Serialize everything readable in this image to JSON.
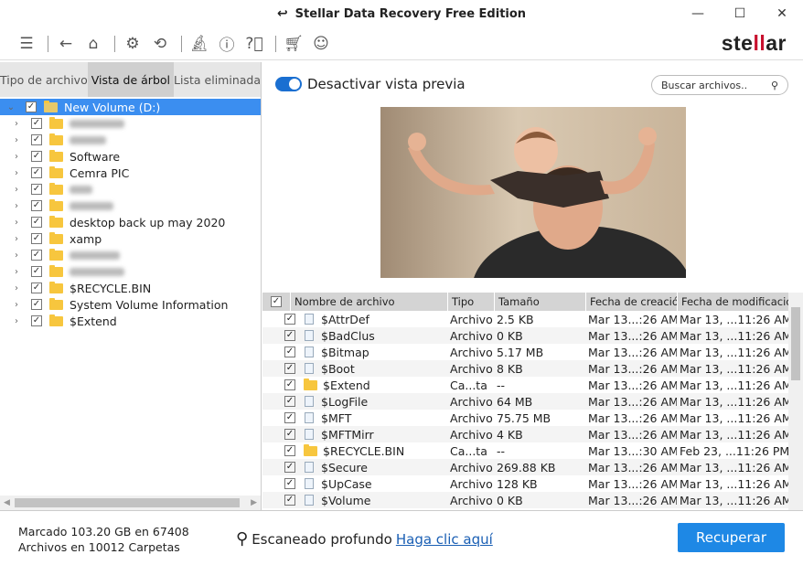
{
  "window": {
    "title": "Stellar Data Recovery Free Edition",
    "minimize": "—",
    "maximize": "☐",
    "close": "✕"
  },
  "toolbar": {
    "logo": "stellar"
  },
  "left": {
    "tabs": [
      "Tipo de archivo",
      "Vista de árbol",
      "Lista eliminada"
    ],
    "tree": [
      {
        "label": "New Volume (D:)",
        "selected": true,
        "expanded": true
      },
      {
        "label": null,
        "blur": 60
      },
      {
        "label": null,
        "blur": 40
      },
      {
        "label": "Software"
      },
      {
        "label": "Cemra PIC"
      },
      {
        "label": null,
        "blur": 25
      },
      {
        "label": null,
        "blur": 48
      },
      {
        "label": "desktop back up may 2020"
      },
      {
        "label": "xamp"
      },
      {
        "label": null,
        "blur": 55
      },
      {
        "label": null,
        "blur": 60
      },
      {
        "label": "$RECYCLE.BIN"
      },
      {
        "label": "System Volume Information"
      },
      {
        "label": "$Extend"
      }
    ]
  },
  "preview": {
    "toggle_label": "Desactivar vista previa",
    "toggle_on": true,
    "search_placeholder": "Buscar archivos.."
  },
  "table": {
    "headers": [
      "Nombre de archivo",
      "Tipo",
      "Tamaño",
      "Fecha de creación",
      "Fecha de modificación"
    ],
    "rows": [
      [
        "$AttrDef",
        "Archivo",
        "2.5 KB",
        "Mar 13...:26 AM",
        "Mar 13, ...11:26 AM",
        "file"
      ],
      [
        "$BadClus",
        "Archivo",
        "0 KB",
        "Mar 13...:26 AM",
        "Mar 13, ...11:26 AM",
        "file"
      ],
      [
        "$Bitmap",
        "Archivo",
        "5.17 MB",
        "Mar 13...:26 AM",
        "Mar 13, ...11:26 AM",
        "file"
      ],
      [
        "$Boot",
        "Archivo",
        "8 KB",
        "Mar 13...:26 AM",
        "Mar 13, ...11:26 AM",
        "file"
      ],
      [
        "$Extend",
        "Ca...ta",
        "--",
        "Mar 13...:26 AM",
        "Mar 13, ...11:26 AM",
        "folder"
      ],
      [
        "$LogFile",
        "Archivo",
        "64 MB",
        "Mar 13...:26 AM",
        "Mar 13, ...11:26 AM",
        "file"
      ],
      [
        "$MFT",
        "Archivo",
        "75.75 MB",
        "Mar 13...:26 AM",
        "Mar 13, ...11:26 AM",
        "file"
      ],
      [
        "$MFTMirr",
        "Archivo",
        "4 KB",
        "Mar 13...:26 AM",
        "Mar 13, ...11:26 AM",
        "file"
      ],
      [
        "$RECYCLE.BIN",
        "Ca...ta",
        "--",
        "Mar 13...:30 AM",
        "Feb 23, ...11:26 PM",
        "folder"
      ],
      [
        "$Secure",
        "Archivo",
        "269.88 KB",
        "Mar 13...:26 AM",
        "Mar 13, ...11:26 AM",
        "file"
      ],
      [
        "$UpCase",
        "Archivo",
        "128 KB",
        "Mar 13...:26 AM",
        "Mar 13, ...11:26 AM",
        "file"
      ],
      [
        "$Volume",
        "Archivo",
        "0 KB",
        "Mar 13...:26 AM",
        "Mar 13, ...11:26 AM",
        "file"
      ]
    ]
  },
  "footer": {
    "marked": "Marcado 103.20 GB en 67408",
    "files": "Archivos en 10012 Carpetas",
    "deep_scan": "Escaneado profundo",
    "deep_link": "Haga clic aquí",
    "recover": "Recuperar"
  },
  "colors": {
    "accent": "#1e88e5",
    "selection": "#3b8ef0",
    "logo_red": "#c8102e"
  }
}
